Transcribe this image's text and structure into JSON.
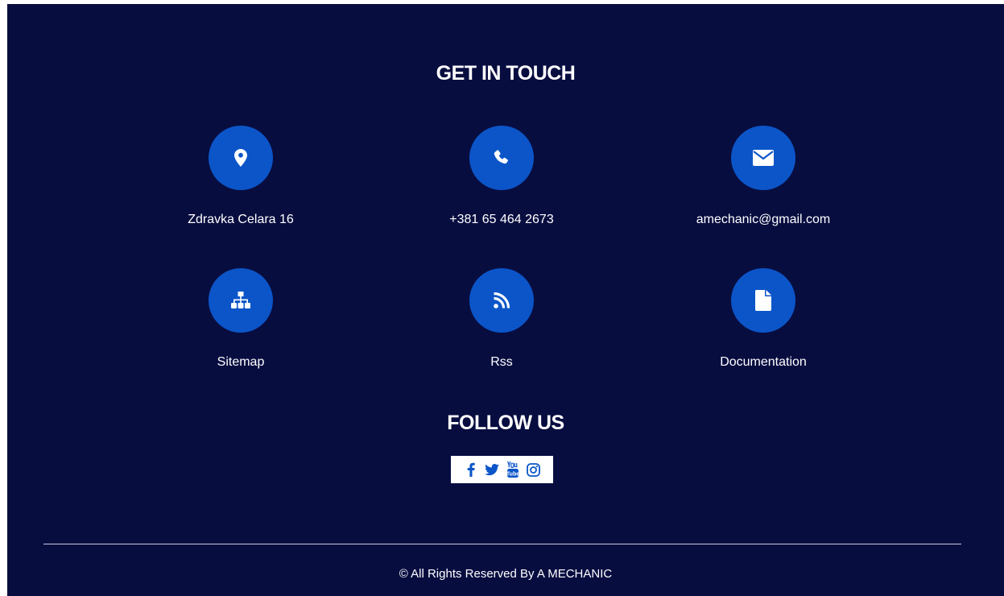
{
  "get_in_touch": {
    "title": "GET IN TOUCH",
    "items": [
      {
        "icon": "map-marker-icon",
        "label": "Zdravka Celara 16"
      },
      {
        "icon": "phone-icon",
        "label": "+381 65 464 2673"
      },
      {
        "icon": "envelope-icon",
        "label": "amechanic@gmail.com"
      },
      {
        "icon": "sitemap-icon",
        "label": "Sitemap"
      },
      {
        "icon": "rss-icon",
        "label": "Rss"
      },
      {
        "icon": "document-icon",
        "label": "Documentation"
      }
    ]
  },
  "follow_us": {
    "title": "FOLLOW US",
    "links": [
      {
        "icon": "facebook-icon"
      },
      {
        "icon": "twitter-icon"
      },
      {
        "icon": "youtube-icon"
      },
      {
        "icon": "instagram-icon"
      }
    ]
  },
  "footer": {
    "copyright": "© All Rights Reserved By A MECHANIC"
  },
  "colors": {
    "background": "#080d40",
    "accent": "#0b55c8",
    "text": "#ffffff"
  }
}
